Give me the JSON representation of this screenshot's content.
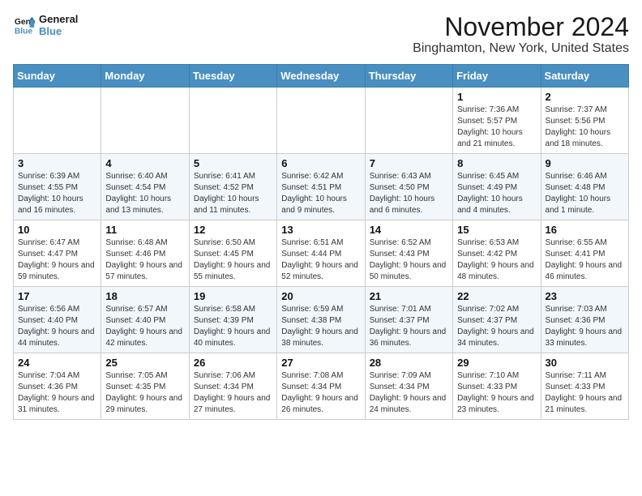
{
  "logo": {
    "line1": "General",
    "line2": "Blue"
  },
  "title": "November 2024",
  "location": "Binghamton, New York, United States",
  "days_of_week": [
    "Sunday",
    "Monday",
    "Tuesday",
    "Wednesday",
    "Thursday",
    "Friday",
    "Saturday"
  ],
  "weeks": [
    [
      {
        "day": "",
        "info": ""
      },
      {
        "day": "",
        "info": ""
      },
      {
        "day": "",
        "info": ""
      },
      {
        "day": "",
        "info": ""
      },
      {
        "day": "",
        "info": ""
      },
      {
        "day": "1",
        "info": "Sunrise: 7:36 AM\nSunset: 5:57 PM\nDaylight: 10 hours and 21 minutes."
      },
      {
        "day": "2",
        "info": "Sunrise: 7:37 AM\nSunset: 5:56 PM\nDaylight: 10 hours and 18 minutes."
      }
    ],
    [
      {
        "day": "3",
        "info": "Sunrise: 6:39 AM\nSunset: 4:55 PM\nDaylight: 10 hours and 16 minutes."
      },
      {
        "day": "4",
        "info": "Sunrise: 6:40 AM\nSunset: 4:54 PM\nDaylight: 10 hours and 13 minutes."
      },
      {
        "day": "5",
        "info": "Sunrise: 6:41 AM\nSunset: 4:52 PM\nDaylight: 10 hours and 11 minutes."
      },
      {
        "day": "6",
        "info": "Sunrise: 6:42 AM\nSunset: 4:51 PM\nDaylight: 10 hours and 9 minutes."
      },
      {
        "day": "7",
        "info": "Sunrise: 6:43 AM\nSunset: 4:50 PM\nDaylight: 10 hours and 6 minutes."
      },
      {
        "day": "8",
        "info": "Sunrise: 6:45 AM\nSunset: 4:49 PM\nDaylight: 10 hours and 4 minutes."
      },
      {
        "day": "9",
        "info": "Sunrise: 6:46 AM\nSunset: 4:48 PM\nDaylight: 10 hours and 1 minute."
      }
    ],
    [
      {
        "day": "10",
        "info": "Sunrise: 6:47 AM\nSunset: 4:47 PM\nDaylight: 9 hours and 59 minutes."
      },
      {
        "day": "11",
        "info": "Sunrise: 6:48 AM\nSunset: 4:46 PM\nDaylight: 9 hours and 57 minutes."
      },
      {
        "day": "12",
        "info": "Sunrise: 6:50 AM\nSunset: 4:45 PM\nDaylight: 9 hours and 55 minutes."
      },
      {
        "day": "13",
        "info": "Sunrise: 6:51 AM\nSunset: 4:44 PM\nDaylight: 9 hours and 52 minutes."
      },
      {
        "day": "14",
        "info": "Sunrise: 6:52 AM\nSunset: 4:43 PM\nDaylight: 9 hours and 50 minutes."
      },
      {
        "day": "15",
        "info": "Sunrise: 6:53 AM\nSunset: 4:42 PM\nDaylight: 9 hours and 48 minutes."
      },
      {
        "day": "16",
        "info": "Sunrise: 6:55 AM\nSunset: 4:41 PM\nDaylight: 9 hours and 46 minutes."
      }
    ],
    [
      {
        "day": "17",
        "info": "Sunrise: 6:56 AM\nSunset: 4:40 PM\nDaylight: 9 hours and 44 minutes."
      },
      {
        "day": "18",
        "info": "Sunrise: 6:57 AM\nSunset: 4:40 PM\nDaylight: 9 hours and 42 minutes."
      },
      {
        "day": "19",
        "info": "Sunrise: 6:58 AM\nSunset: 4:39 PM\nDaylight: 9 hours and 40 minutes."
      },
      {
        "day": "20",
        "info": "Sunrise: 6:59 AM\nSunset: 4:38 PM\nDaylight: 9 hours and 38 minutes."
      },
      {
        "day": "21",
        "info": "Sunrise: 7:01 AM\nSunset: 4:37 PM\nDaylight: 9 hours and 36 minutes."
      },
      {
        "day": "22",
        "info": "Sunrise: 7:02 AM\nSunset: 4:37 PM\nDaylight: 9 hours and 34 minutes."
      },
      {
        "day": "23",
        "info": "Sunrise: 7:03 AM\nSunset: 4:36 PM\nDaylight: 9 hours and 33 minutes."
      }
    ],
    [
      {
        "day": "24",
        "info": "Sunrise: 7:04 AM\nSunset: 4:36 PM\nDaylight: 9 hours and 31 minutes."
      },
      {
        "day": "25",
        "info": "Sunrise: 7:05 AM\nSunset: 4:35 PM\nDaylight: 9 hours and 29 minutes."
      },
      {
        "day": "26",
        "info": "Sunrise: 7:06 AM\nSunset: 4:34 PM\nDaylight: 9 hours and 27 minutes."
      },
      {
        "day": "27",
        "info": "Sunrise: 7:08 AM\nSunset: 4:34 PM\nDaylight: 9 hours and 26 minutes."
      },
      {
        "day": "28",
        "info": "Sunrise: 7:09 AM\nSunset: 4:34 PM\nDaylight: 9 hours and 24 minutes."
      },
      {
        "day": "29",
        "info": "Sunrise: 7:10 AM\nSunset: 4:33 PM\nDaylight: 9 hours and 23 minutes."
      },
      {
        "day": "30",
        "info": "Sunrise: 7:11 AM\nSunset: 4:33 PM\nDaylight: 9 hours and 21 minutes."
      }
    ]
  ]
}
